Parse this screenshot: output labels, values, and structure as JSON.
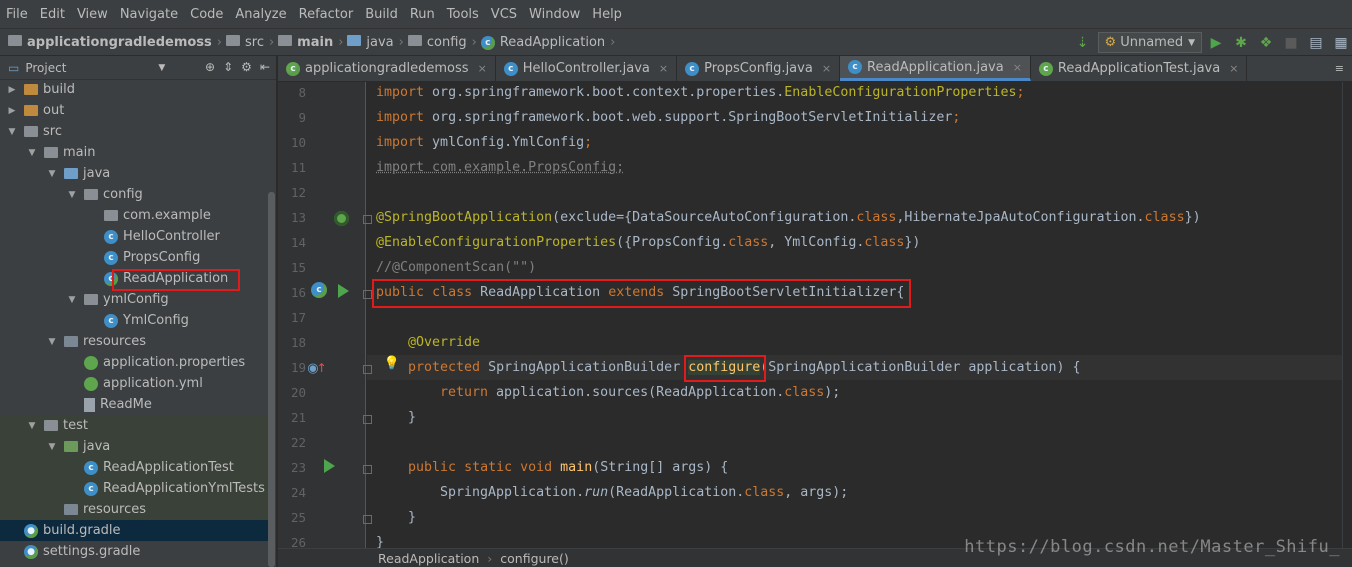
{
  "menu": [
    "File",
    "Edit",
    "View",
    "Navigate",
    "Code",
    "Analyze",
    "Refactor",
    "Build",
    "Run",
    "Tools",
    "VCS",
    "Window",
    "Help"
  ],
  "nav": {
    "crumbs": [
      "applicationgradledemoss",
      "src",
      "main",
      "java",
      "config",
      "ReadApplication"
    ],
    "run_config": "Unnamed"
  },
  "project": {
    "header": "Project",
    "tree": [
      {
        "label": "build",
        "depth": 1,
        "arrow": "right",
        "icon": "folder-orange"
      },
      {
        "label": "out",
        "depth": 1,
        "arrow": "right",
        "icon": "folder-orange"
      },
      {
        "label": "src",
        "depth": 1,
        "arrow": "down",
        "icon": "folder"
      },
      {
        "label": "main",
        "depth": 2,
        "arrow": "down",
        "icon": "folder"
      },
      {
        "label": "java",
        "depth": 3,
        "arrow": "down",
        "icon": "folder-blue"
      },
      {
        "label": "config",
        "depth": 4,
        "arrow": "down",
        "icon": "package"
      },
      {
        "label": "com.example",
        "depth": 5,
        "arrow": "",
        "icon": "package"
      },
      {
        "label": "HelloController",
        "depth": 5,
        "arrow": "",
        "icon": "class"
      },
      {
        "label": "PropsConfig",
        "depth": 5,
        "arrow": "",
        "icon": "class"
      },
      {
        "label": "ReadApplication",
        "depth": 5,
        "arrow": "",
        "icon": "class-run"
      },
      {
        "label": "ymlConfig",
        "depth": 4,
        "arrow": "down",
        "icon": "package"
      },
      {
        "label": "YmlConfig",
        "depth": 5,
        "arrow": "",
        "icon": "class"
      },
      {
        "label": "resources",
        "depth": 3,
        "arrow": "down",
        "icon": "folder-res"
      },
      {
        "label": "application.properties",
        "depth": 4,
        "arrow": "",
        "icon": "leaf"
      },
      {
        "label": "application.yml",
        "depth": 4,
        "arrow": "",
        "icon": "leaf"
      },
      {
        "label": "ReadMe",
        "depth": 4,
        "arrow": "",
        "icon": "file"
      },
      {
        "label": "test",
        "depth": 2,
        "arrow": "down",
        "icon": "folder"
      },
      {
        "label": "java",
        "depth": 3,
        "arrow": "down",
        "icon": "folder-green"
      },
      {
        "label": "ReadApplicationTest",
        "depth": 4,
        "arrow": "",
        "icon": "class"
      },
      {
        "label": "ReadApplicationYmlTests",
        "depth": 4,
        "arrow": "",
        "icon": "class"
      },
      {
        "label": "resources",
        "depth": 3,
        "arrow": "",
        "icon": "folder-res"
      },
      {
        "label": "build.gradle",
        "depth": 1,
        "arrow": "",
        "icon": "gradle"
      },
      {
        "label": "settings.gradle",
        "depth": 1,
        "arrow": "",
        "icon": "gradle"
      }
    ]
  },
  "tabs": [
    {
      "label": "applicationgradledemoss",
      "icon": "module"
    },
    {
      "label": "HelloController.java",
      "icon": "class"
    },
    {
      "label": "PropsConfig.java",
      "icon": "class"
    },
    {
      "label": "ReadApplication.java",
      "icon": "class-run"
    },
    {
      "label": "ReadApplicationTest.java",
      "icon": "class-test"
    }
  ],
  "code": {
    "line_numbers": [
      "8",
      "9",
      "10",
      "11",
      "12",
      "13",
      "14",
      "15",
      "16",
      "17",
      "18",
      "19",
      "20",
      "21",
      "22",
      "23",
      "24",
      "25",
      "26"
    ],
    "l8": {
      "kw": "import",
      "rest": " org.springframework.boot.context.properties.",
      "cls": "EnableConfigurationProperties",
      "end": ";"
    },
    "l9": {
      "kw": "import",
      "rest": " org.springframework.boot.web.support.SpringBootServletInitializer",
      "end": ";"
    },
    "l10": {
      "kw": "import",
      "rest": " ymlConfig.YmlConfig",
      "end": ";"
    },
    "l11": {
      "text": "import com.example.PropsConfig;"
    },
    "l13": {
      "ann": "@SpringBootApplication",
      "p1": "(exclude={DataSourceAutoConfiguration.",
      "k1": "class",
      "p2": ",HibernateJpaAutoConfiguration.",
      "k2": "class",
      "p3": "})"
    },
    "l14": {
      "ann": "@EnableConfigurationProperties",
      "p1": "({PropsConfig.",
      "k1": "class",
      "p2": ", YmlConfig.",
      "k2": "class",
      "p3": "})"
    },
    "l15": {
      "text": "//@ComponentScan(\"\")"
    },
    "l16": {
      "k1": "public",
      "k2": "class",
      "name": " ReadApplication ",
      "k3": "extends",
      "rest": " SpringBootServletInitializer{"
    },
    "l18": {
      "ann": "@Override"
    },
    "l19": {
      "kw": "protected",
      "type": " SpringApplicationBuilder ",
      "method": "configure",
      "rest": "(SpringApplicationBuilder application) {"
    },
    "l20": {
      "kw": "return",
      "rest": " application.sources(ReadApplication.",
      "k2": "class",
      "end": ");"
    },
    "l21": {
      "text": "}"
    },
    "l23": {
      "k1": "public",
      "k2": "static",
      "k3": "void",
      "method": "main",
      "rest": "(String[] args) {"
    },
    "l24": {
      "pre": "SpringApplication.",
      "italic": "run",
      "mid": "(ReadApplication.",
      "k2": "class",
      "end": ", args);"
    },
    "l25": {
      "text": "}"
    },
    "l26": {
      "text": "}"
    }
  },
  "breadcrumb": [
    "ReadApplication",
    "configure()"
  ],
  "watermark": "https://blog.csdn.net/Master_Shifu_",
  "colors": {
    "highlight_box": "#e01b1b",
    "keyword": "#cc7832",
    "annotation": "#bbb529",
    "method": "#ffc66d"
  }
}
